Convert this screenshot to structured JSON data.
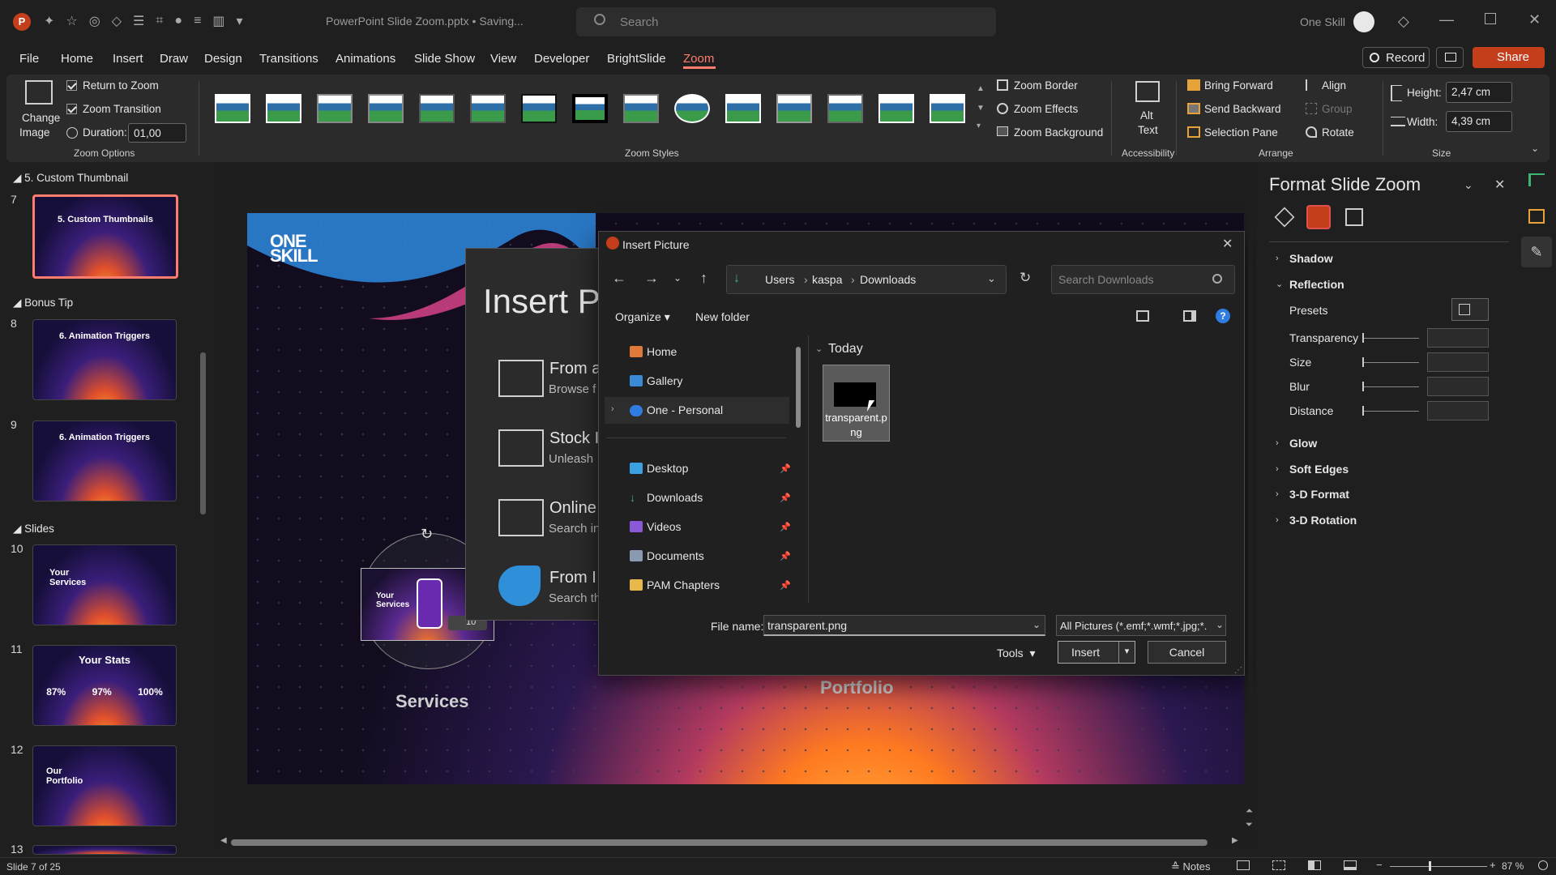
{
  "app": {
    "doc_title": "PowerPoint Slide Zoom.pptx • Saving...",
    "search_placeholder": "Search",
    "user_name": "One Skill",
    "colors": {
      "accent": "#c43e1c",
      "bg": "#1f1f1f",
      "ribbon": "#2b2b2b",
      "zoom_tab": "#ff7c6e"
    }
  },
  "menu": {
    "items": [
      "File",
      "Home",
      "Insert",
      "Draw",
      "Design",
      "Transitions",
      "Animations",
      "Slide Show",
      "View",
      "Developer",
      "BrightSlide",
      "Zoom"
    ],
    "active": "Zoom",
    "record": "Record",
    "share": "Share"
  },
  "ribbon": {
    "change_image": [
      "Change",
      "Image"
    ],
    "return_to_zoom": "Return to Zoom",
    "zoom_transition": "Zoom Transition",
    "duration_label": "Duration:",
    "duration_value": "01,00",
    "zoom_options_label": "Zoom Options",
    "zoom_styles_label": "Zoom Styles",
    "zoom_border": "Zoom Border",
    "zoom_effects": "Zoom Effects",
    "zoom_background": "Zoom Background",
    "alt_text": [
      "Alt",
      "Text"
    ],
    "accessibility_label": "Accessibility",
    "bring_forward": "Bring Forward",
    "send_backward": "Send Backward",
    "selection_pane": "Selection Pane",
    "align": "Align",
    "group": "Group",
    "rotate": "Rotate",
    "arrange_label": "Arrange",
    "height_label": "Height:",
    "height_value": "2,47 cm",
    "width_label": "Width:",
    "width_value": "4,39 cm",
    "size_label": "Size"
  },
  "thumbnails": {
    "sections": [
      "5. Custom Thumbnail",
      "Bonus Tip",
      "Slides"
    ],
    "slides": [
      {
        "num": "7",
        "title": "5. Custom Thumbnails"
      },
      {
        "num": "8",
        "title": "6. Animation Triggers"
      },
      {
        "num": "9",
        "title": "6. Animation Triggers"
      },
      {
        "num": "10",
        "title": "Your Services"
      },
      {
        "num": "11",
        "title": "Your Stats",
        "stats": [
          "87%",
          "97%",
          "100%"
        ]
      },
      {
        "num": "12",
        "title": "Our Portfolio"
      },
      {
        "num": "13",
        "title": ""
      }
    ]
  },
  "slide": {
    "logo": [
      "ONE",
      "SKILL"
    ],
    "services_label": "Services",
    "portfolio_label": "Portfolio",
    "zoom_thumb_title": "Your Services",
    "zoom_badge": "10"
  },
  "insert_panel": {
    "title": "Insert P",
    "items": [
      {
        "label": "From a",
        "sub": "Browse f"
      },
      {
        "label": "Stock I",
        "sub": "Unleash"
      },
      {
        "label": "Online",
        "sub": "Search in"
      },
      {
        "label": "From I",
        "sub": "Search th"
      }
    ]
  },
  "dialog": {
    "title": "Insert Picture",
    "breadcrumb": [
      "Users",
      "kaspa",
      "Downloads"
    ],
    "search_placeholder": "Search Downloads",
    "organize": "Organize",
    "new_folder": "New folder",
    "nav": [
      {
        "label": "Home",
        "icon": "home-icon",
        "color": "#e07a3a"
      },
      {
        "label": "Gallery",
        "icon": "gallery-icon",
        "color": "#3a8ad6"
      },
      {
        "label": "One - Personal",
        "icon": "cloud-icon",
        "color": "#2f7de1"
      },
      {
        "label": "Desktop",
        "icon": "desktop-icon",
        "color": "#3aa0e0"
      },
      {
        "label": "Downloads",
        "icon": "download-icon",
        "color": "#3cb371"
      },
      {
        "label": "Videos",
        "icon": "videos-icon",
        "color": "#8a5ad6"
      },
      {
        "label": "Documents",
        "icon": "documents-icon",
        "color": "#8a9ab0"
      },
      {
        "label": "PAM Chapters",
        "icon": "folder-icon",
        "color": "#e8b84a"
      }
    ],
    "group_label": "Today",
    "file": "transparent.png",
    "file_name_label": "File name:",
    "file_name_value": "transparent.png",
    "filter": "All Pictures (*.emf;*.wmf;*.jpg;*.",
    "tools": "Tools",
    "insert": "Insert",
    "cancel": "Cancel"
  },
  "format_pane": {
    "title": "Format Slide Zoom",
    "sections": [
      "Shadow",
      "Reflection",
      "Glow",
      "Soft Edges",
      "3-D Format",
      "3-D Rotation"
    ],
    "reflection_fields": [
      "Presets",
      "Transparency",
      "Size",
      "Blur",
      "Distance"
    ]
  },
  "status": {
    "slide": "Slide 7 of 25",
    "notes": "Notes",
    "zoom": "87 %"
  }
}
